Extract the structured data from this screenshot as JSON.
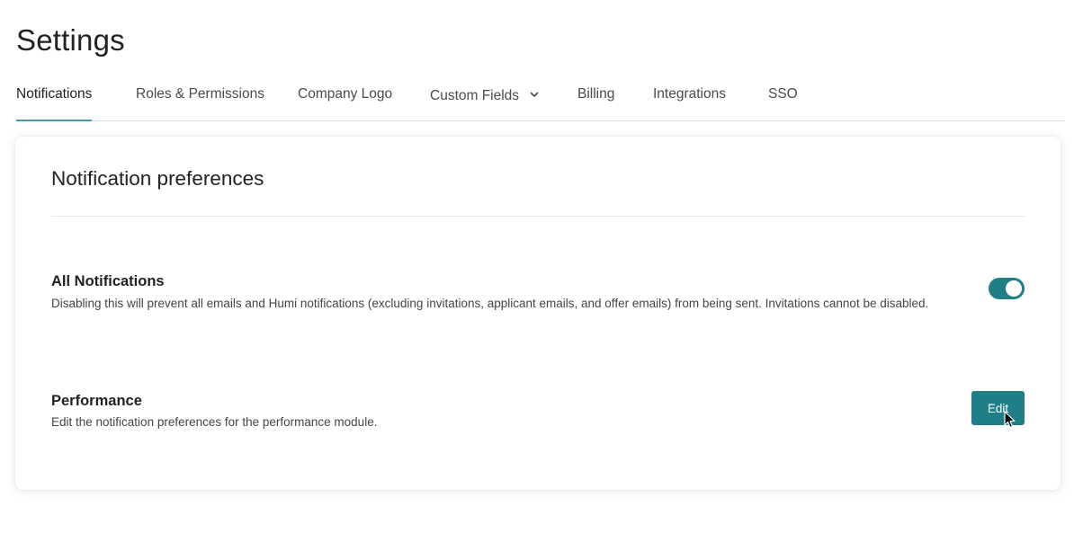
{
  "page": {
    "title": "Settings"
  },
  "tabs": [
    {
      "label": "Notifications",
      "active": true
    },
    {
      "label": "Roles & Permissions",
      "active": false
    },
    {
      "label": "Company Logo",
      "active": false
    },
    {
      "label": "Custom Fields",
      "active": false,
      "icon": "chevron-down-icon"
    },
    {
      "label": "Billing",
      "active": false
    },
    {
      "label": "Integrations",
      "active": false
    },
    {
      "label": "SSO",
      "active": false
    }
  ],
  "card": {
    "title": "Notification preferences",
    "all_notifications": {
      "title": "All Notifications",
      "description": "Disabling this will prevent all emails and Humi notifications (excluding invitations, applicant emails, and offer emails) from being sent. Invitations cannot be disabled.",
      "enabled": true
    },
    "performance": {
      "title": "Performance",
      "description": "Edit the notification preferences for the performance module.",
      "button_label": "Edit"
    }
  },
  "colors": {
    "accent": "#1e7f89",
    "tab_underline": "#4a9aa6"
  }
}
